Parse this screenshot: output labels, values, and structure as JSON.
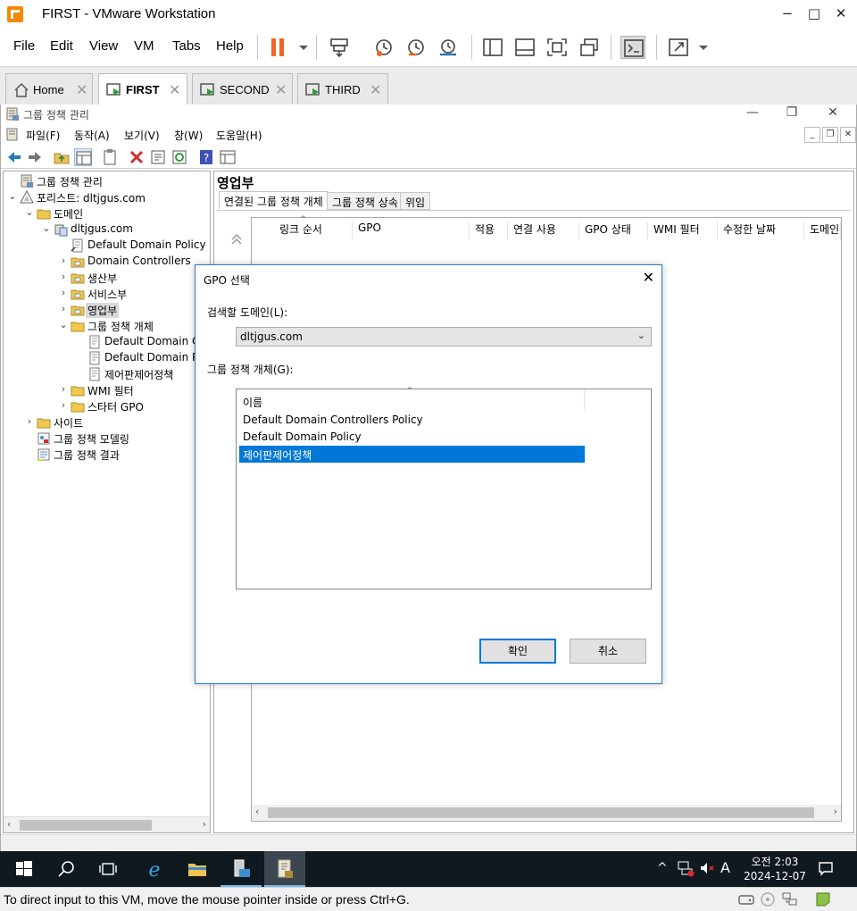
{
  "vmware": {
    "title": "FIRST - VMware Workstation",
    "menu": [
      "File",
      "Edit",
      "View",
      "VM",
      "Tabs",
      "Help"
    ],
    "window_controls": {
      "minimize": "−",
      "maximize": "□",
      "close": "✕"
    },
    "tabs": [
      {
        "label": "Home",
        "icon": "home-icon",
        "active": false
      },
      {
        "label": "FIRST",
        "icon": "vm-icon",
        "active": true
      },
      {
        "label": "SECOND",
        "icon": "vm-icon",
        "active": false
      },
      {
        "label": "THIRD",
        "icon": "vm-icon",
        "active": false
      }
    ],
    "tab_close": "✕",
    "status_text": "To direct input to this VM, move the mouse pointer inside or press Ctrl+G."
  },
  "gpmc": {
    "title": "그룹 정책 관리",
    "menu": [
      "파일(F)",
      "동작(A)",
      "보기(V)",
      "창(W)",
      "도움말(H)"
    ],
    "tree": [
      {
        "label": "그룹 정책 관리",
        "expander": "",
        "icon": "gpmc-icon"
      },
      {
        "label": "포리스트: dltjgus.com",
        "expander": "⌄",
        "icon": "forest-icon"
      },
      {
        "label": "도메인",
        "expander": "⌄",
        "icon": "folder-icon"
      },
      {
        "label": "dltjgus.com",
        "expander": "⌄",
        "icon": "domain-icon"
      },
      {
        "label": "Default Domain Policy",
        "expander": "",
        "icon": "gpo-link-icon"
      },
      {
        "label": "Domain Controllers",
        "expander": "›",
        "icon": "ou-icon"
      },
      {
        "label": "생산부",
        "expander": "›",
        "icon": "ou-icon"
      },
      {
        "label": "서비스부",
        "expander": "›",
        "icon": "ou-icon"
      },
      {
        "label": "영업부",
        "expander": "›",
        "icon": "ou-icon",
        "selected": true
      },
      {
        "label": "그룹 정책 개체",
        "expander": "⌄",
        "icon": "folder-icon"
      },
      {
        "label": "Default Domain C",
        "expander": "",
        "icon": "gpo-icon"
      },
      {
        "label": "Default Domain P",
        "expander": "",
        "icon": "gpo-icon"
      },
      {
        "label": "제어판제어정책",
        "expander": "",
        "icon": "gpo-icon"
      },
      {
        "label": "WMI 필터",
        "expander": "›",
        "icon": "folder-icon"
      },
      {
        "label": "스타터 GPO",
        "expander": "›",
        "icon": "folder-icon"
      },
      {
        "label": "사이트",
        "expander": "›",
        "icon": "folder-icon"
      },
      {
        "label": "그룹 정책 모델링",
        "expander": "",
        "icon": "modeling-icon"
      },
      {
        "label": "그룹 정책 결과",
        "expander": "",
        "icon": "results-icon"
      }
    ],
    "right_pane": {
      "header": "영업부",
      "tabs": [
        "연결된 그룹 정책 개체",
        "그룹 정책 상속",
        "위임"
      ],
      "columns": [
        "링크 순서",
        "GPO",
        "적용",
        "연결 사용",
        "GPO 상태",
        "WMI 필터",
        "수정한 날짜",
        "도메인"
      ]
    }
  },
  "dialog": {
    "title": "GPO 선택",
    "close": "✕",
    "domain_label": "검색할 도메인(L):",
    "domain_value": "dltjgus.com",
    "gpo_label": "그룹 정책 개체(G):",
    "list_header": "이름",
    "items": [
      "Default Domain Controllers Policy",
      "Default Domain Policy",
      "제어판제어정책"
    ],
    "selected_index": 2,
    "ok": "확인",
    "cancel": "취소"
  },
  "taskbar": {
    "time": "오전 2:03",
    "date": "2024-12-07",
    "ime": "A"
  },
  "colors": {
    "selection": "#0078d7",
    "taskbar": "#101820",
    "pause_orange": "#f26522"
  }
}
